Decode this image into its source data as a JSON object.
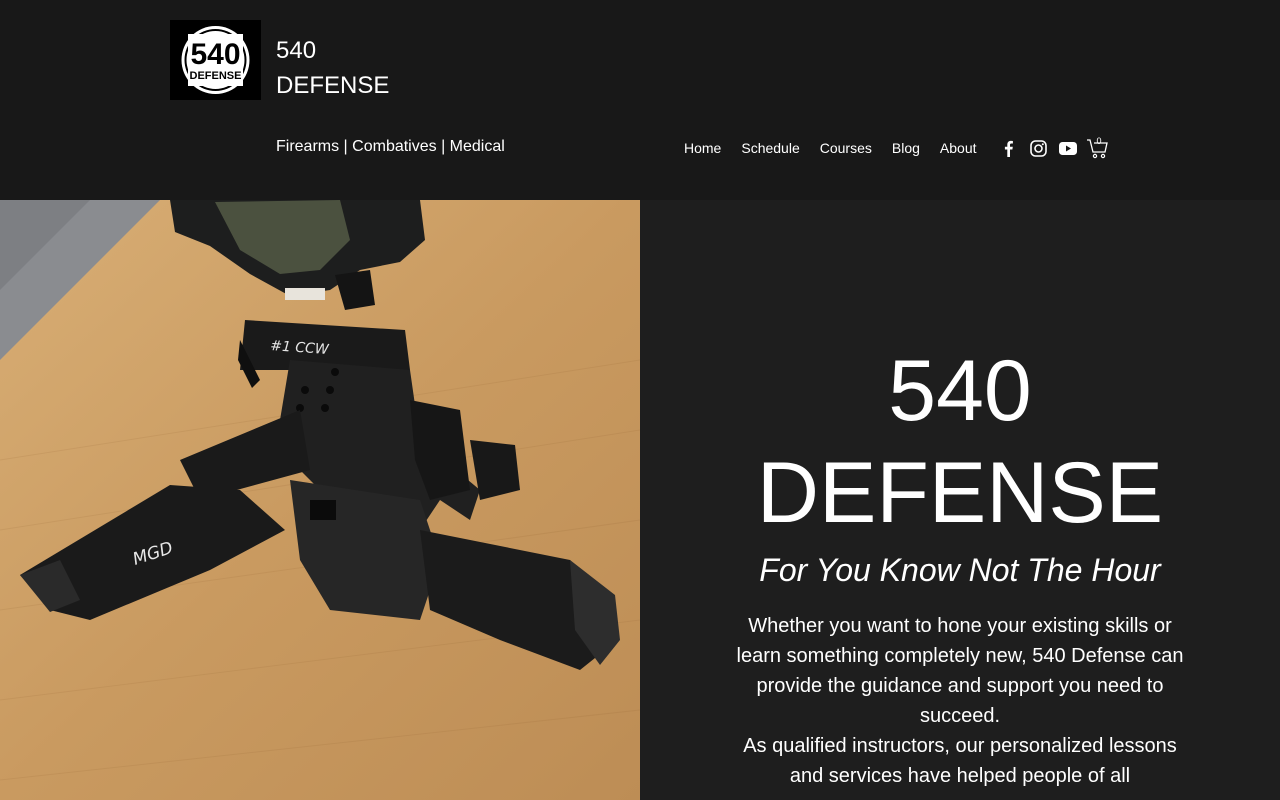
{
  "header": {
    "logo": {
      "top": "540",
      "bottom": "DEFENSE"
    },
    "brand_line1": "540",
    "brand_line2": "DEFENSE",
    "tagline": "Firearms | Combatives | Medical"
  },
  "nav": [
    {
      "label": "Home"
    },
    {
      "label": "Schedule"
    },
    {
      "label": "Courses"
    },
    {
      "label": "Blog"
    },
    {
      "label": "About"
    }
  ],
  "social": [
    "facebook-icon",
    "instagram-icon",
    "youtube-icon"
  ],
  "cart": {
    "count": "0"
  },
  "hero": {
    "title_line1": "540",
    "title_line2": "DEFENSE",
    "subtitle": "For You Know Not The Hour",
    "paragraph1": "Whether you want to hone your existing skills or learn something completely new, 540 Defense can provide the guidance and support you need to succeed.",
    "paragraph2": "As qualified instructors, our personalized lessons and services have helped people of all"
  },
  "colors": {
    "header_bg": "#181818",
    "hero_bg": "#1e1e1e",
    "text": "#ffffff",
    "photo_table": "#c79a62"
  },
  "photo": {
    "mag_text_1": "#1 CCW",
    "mag_text_2": "MGD"
  }
}
